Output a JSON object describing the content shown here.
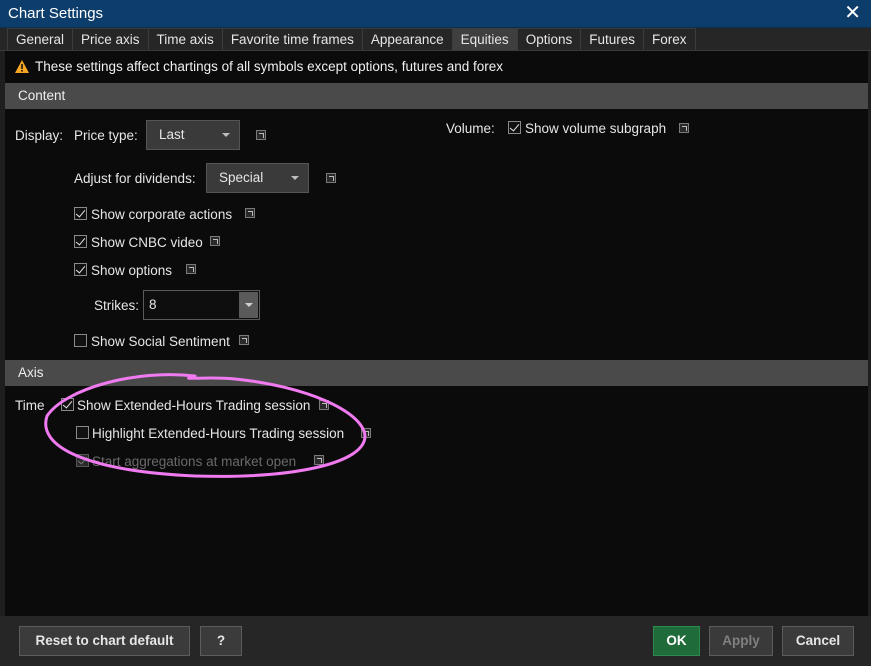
{
  "window": {
    "title": "Chart Settings",
    "close_glyph": "✕"
  },
  "tabs": [
    "General",
    "Price axis",
    "Time axis",
    "Favorite time frames",
    "Appearance",
    "Equities",
    "Options",
    "Futures",
    "Forex"
  ],
  "active_tab": "Equities",
  "warning": {
    "text": "These settings affect chartings of all symbols except options, futures and forex",
    "icon": "warning-icon",
    "color": "#f5a623"
  },
  "content_section": {
    "header": "Content",
    "display_label": "Display:",
    "price_type_label": "Price type:",
    "price_type_value": "Last",
    "volume_label": "Volume:",
    "show_volume_subgraph": {
      "label": "Show volume subgraph",
      "checked": true
    },
    "adjust_dividends_label": "Adjust for dividends:",
    "adjust_dividends_value": "Special",
    "show_corporate_actions": {
      "label": "Show corporate actions",
      "checked": true
    },
    "show_cnbc_video": {
      "label": "Show CNBC video",
      "checked": true
    },
    "show_options": {
      "label": "Show options",
      "checked": true
    },
    "strikes_label": "Strikes:",
    "strikes_value": "8",
    "show_social_sentiment": {
      "label": "Show Social Sentiment",
      "checked": false
    }
  },
  "axis_section": {
    "header": "Axis",
    "time_label": "Time",
    "show_extended_hours": {
      "label": "Show Extended-Hours Trading session",
      "checked": true
    },
    "highlight_extended_hours": {
      "label": "Highlight Extended-Hours Trading session",
      "checked": false
    },
    "start_aggregations": {
      "label": "Start aggregations at market open",
      "checked": true,
      "disabled": true
    }
  },
  "annotation": {
    "color": "#f07af0"
  },
  "footer": {
    "reset_label": "Reset to chart default",
    "help_glyph": "?",
    "ok_label": "OK",
    "apply_label": "Apply",
    "cancel_label": "Cancel"
  }
}
